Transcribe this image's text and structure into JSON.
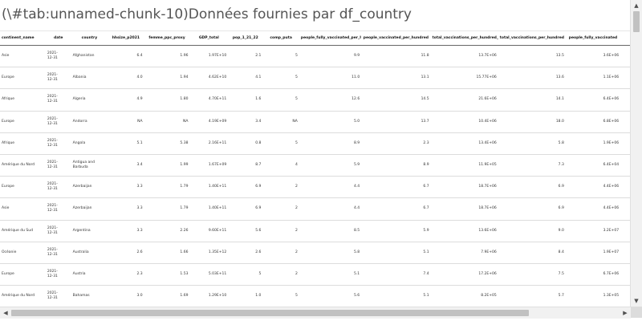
{
  "caption": "(\\#tab:unnamed-chunk-10)Données fournies par df_country",
  "table": {
    "columns": [
      "continent_name",
      "date",
      "country",
      "hhsize_p2021",
      "femme_ppc_proxy",
      "GDP_total",
      "pop_1_21_22",
      "comp_puta",
      "people_fully_vaccinated_per_hundred",
      "people_vaccinated_per_hundred",
      "total_vaccinations_per_hundred_pp",
      "total_vaccinations_per_hundred",
      "people_fully_vaccinated",
      "total_cases"
    ],
    "rows": [
      [
        "Asie",
        "2021-\n12-31",
        "Afghanistan",
        "6.4",
        "1.96",
        "1.97E+10",
        "2.1",
        "5",
        "9.9",
        "11.8",
        "13.7E+06",
        "13.5",
        "3.6E+06",
        "1.2E+05"
      ],
      [
        "Europe",
        "2021-\n12-31",
        "Albania",
        "4.0",
        "1.94",
        "4.62E+10",
        "4.1",
        "5",
        "11.0",
        "13.1",
        "15.77E+06",
        "13.6",
        "1.1E+06",
        "2.1E+05"
      ],
      [
        "Afrique",
        "2021-\n12-31",
        "Algeria",
        "4.9",
        "1.80",
        "4.70E+11",
        "1.6",
        "5",
        "12.6",
        "14.5",
        "21.6E+06",
        "14.1",
        "6.4E+06",
        "2.2E+05"
      ],
      [
        "Europe",
        "2021-\n12-31",
        "Andorra",
        "NA",
        "NA",
        "4.19E+09",
        "3.4",
        "NA",
        "5.0",
        "13.7",
        "10.4E+06",
        "18.0",
        "6.8E+06",
        "2.3E+04"
      ],
      [
        "Afrique",
        "2021-\n12-31",
        "Angola",
        "5.1",
        "5.38",
        "2.16E+11",
        "0.8",
        "5",
        "8.9",
        "2.3",
        "13.4E+06",
        "5.8",
        "1.9E+06",
        "8.2E+04"
      ],
      [
        "Amérique du Nord",
        "2021-\n12-31",
        "Antigua and Barbuda",
        "3.4",
        "1.99",
        "1.67E+09",
        "8.7",
        "4",
        "5.9",
        "8.9",
        "11.9E+05",
        "7.3",
        "6.4E+04",
        "4.1E+03"
      ],
      [
        "Europe",
        "2021-\n12-31",
        "Azerbaijan",
        "3.3",
        "1.79",
        "1.40E+11",
        "6.9",
        "2",
        "4.4",
        "6.7",
        "18.7E+06",
        "6.9",
        "4.4E+06",
        "6.1E+05"
      ],
      [
        "Asie",
        "2021-\n12-31",
        "Azerbaijan",
        "3.3",
        "1.79",
        "1.40E+11",
        "6.9",
        "2",
        "4.4",
        "6.7",
        "18.7E+06",
        "6.9",
        "4.4E+06",
        "6.1E+05"
      ],
      [
        "Amérique du Sud",
        "2021-\n12-31",
        "Argentina",
        "3.3",
        "2.26",
        "9.60E+11",
        "5.6",
        "2",
        "8.5",
        "5.9",
        "13.6E+06",
        "9.0",
        "3.2E+07",
        "4.9E+06"
      ],
      [
        "Océanie",
        "2021-\n12-31",
        "Australia",
        "2.6",
        "1.66",
        "1.35E+12",
        "2.6",
        "2",
        "5.8",
        "5.1",
        "7.9E+06",
        "8.4",
        "1.9E+07",
        "4.6E+05"
      ],
      [
        "Europe",
        "2021-\n12-31",
        "Austria",
        "2.3",
        "1.53",
        "5.03E+11",
        "5",
        "2",
        "5.1",
        "7.4",
        "17.2E+06",
        "7.5",
        "6.7E+06",
        "1.3E+06"
      ],
      [
        "Amérique du Nord",
        "2021-\n12-31",
        "Bahamas",
        "3.0",
        "1.69",
        "1.29E+10",
        "1.0",
        "5",
        "5.6",
        "5.1",
        "8.2E+05",
        "5.7",
        "1.3E+05",
        "2.6E+04"
      ]
    ]
  }
}
